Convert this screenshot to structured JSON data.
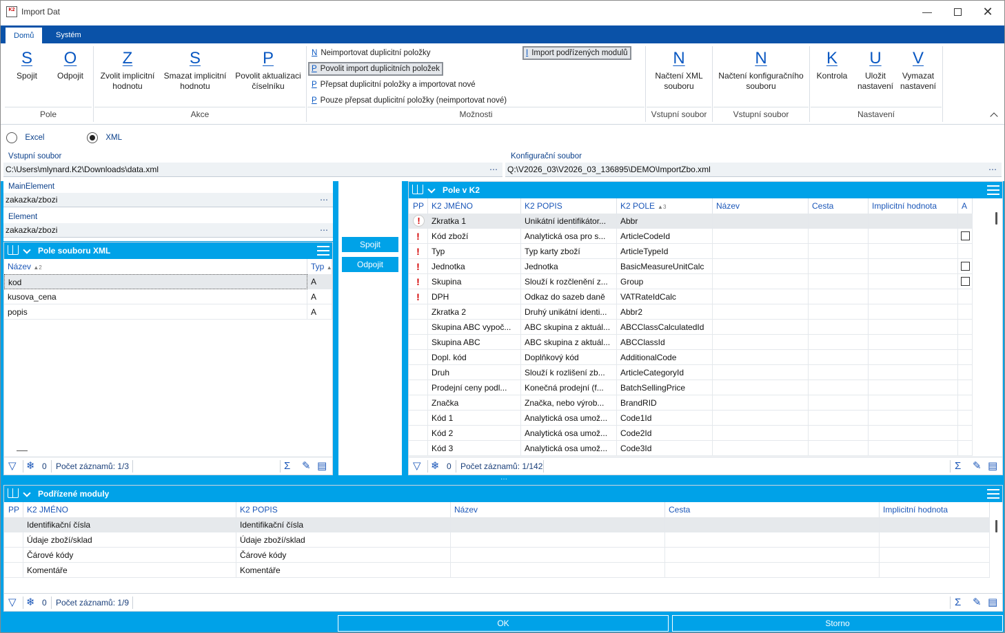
{
  "window": {
    "title": "Import Dat",
    "app_icon": "K2"
  },
  "ribbon": {
    "tabs": [
      "Domů",
      "Systém"
    ],
    "buttons": {
      "spojit": {
        "key": "S",
        "label": "Spojit"
      },
      "odpojit": {
        "key": "O",
        "label": "Odpojit"
      },
      "zvolit": {
        "key": "Z",
        "label1": "Zvolit implicitní",
        "label2": "hodnotu"
      },
      "smazat": {
        "key": "S",
        "label1": "Smazat implicitní",
        "label2": "hodnotu"
      },
      "povolit": {
        "key": "P",
        "label1": "Povolit aktualizaci",
        "label2": "číselníku"
      },
      "nacteni_xml": {
        "key": "N",
        "label1": "Načtení XML",
        "label2": "souboru"
      },
      "nacteni_konf": {
        "key": "N",
        "label1": "Načtení konfiguračního",
        "label2": "souboru"
      },
      "kontrola": {
        "key": "K",
        "label": "Kontrola"
      },
      "ulozit": {
        "key": "U",
        "label1": "Uložit",
        "label2": "nastavení"
      },
      "vymazat": {
        "key": "V",
        "label1": "Vymazat",
        "label2": "nastavení"
      }
    },
    "options": [
      {
        "key": "N",
        "label": "Neimportovat duplicitní položky"
      },
      {
        "key": "P",
        "label": "Povolit import duplicitních položek"
      },
      {
        "key": "P",
        "label": "Přepsat duplicitní položky a importovat nové"
      },
      {
        "key": "P",
        "label": "Pouze přepsat duplicitní položky (neimportovat nové)"
      }
    ],
    "import_sub": {
      "key": "I",
      "label": "Import podřízených modulů"
    },
    "groups": {
      "pole": "Pole",
      "akce": "Akce",
      "moznosti": "Možnosti",
      "vstup1": "Vstupní soubor",
      "vstup2": "Vstupní soubor",
      "nastaveni": "Nastavení"
    }
  },
  "source": {
    "excel": "Excel",
    "xml": "XML",
    "selected": "XML"
  },
  "input_file": {
    "label": "Vstupní soubor",
    "value": "C:\\Users\\mlynard.K2\\Downloads\\data.xml"
  },
  "config_file": {
    "label": "Konfigurační soubor",
    "value": "Q:\\V2026_03\\V2026_03_136895\\DEMO\\ImportZbo.xml"
  },
  "main_element": {
    "label": "MainElement",
    "value": "zakazka/zbozi"
  },
  "element": {
    "label": "Element",
    "value": "zakazka/zbozi"
  },
  "xml_panel": {
    "title": "Pole souboru XML",
    "columns": [
      "Název",
      "Typ"
    ],
    "sort_idx": "2",
    "rows": [
      {
        "name": "kod",
        "typ": "A"
      },
      {
        "name": "kusova_cena",
        "typ": "A"
      },
      {
        "name": "popis",
        "typ": "A"
      }
    ],
    "footer": {
      "count": "0",
      "records": "Počet záznamů: 1/3"
    }
  },
  "middle": {
    "spojit": "Spojit",
    "odpojit": "Odpojit"
  },
  "k2_panel": {
    "title": "Pole v K2",
    "columns": [
      "PP",
      "K2 JMÉNO",
      "K2 POPIS",
      "K2 POLE",
      "Název",
      "Cesta",
      "Implicitní hodnota",
      "A"
    ],
    "sort_idx": "3",
    "rows": [
      {
        "pp": "!",
        "name": "Zkratka 1",
        "desc": "Unikátní identifikátor...",
        "field": "Abbr",
        "chk": false
      },
      {
        "pp": "!",
        "name": "Kód zboží",
        "desc": "Analytická osa pro s...",
        "field": "ArticleCodeId",
        "chk": true
      },
      {
        "pp": "!",
        "name": "Typ",
        "desc": "Typ karty zboží",
        "field": "ArticleTypeId",
        "chk": false
      },
      {
        "pp": "!",
        "name": "Jednotka",
        "desc": "Jednotka",
        "field": "BasicMeasureUnitCalc",
        "chk": true
      },
      {
        "pp": "!",
        "name": "Skupina",
        "desc": "Slouží k rozčlenění z...",
        "field": "Group",
        "chk": true
      },
      {
        "pp": "!",
        "name": "DPH",
        "desc": "Odkaz do sazeb daně",
        "field": "VATRateIdCalc",
        "chk": false
      },
      {
        "pp": "",
        "name": "Zkratka 2",
        "desc": "Druhý unikátní identi...",
        "field": "Abbr2",
        "chk": false
      },
      {
        "pp": "",
        "name": "Skupina ABC vypoč...",
        "desc": "ABC skupina z aktuál...",
        "field": "ABCClassCalculatedId",
        "chk": false
      },
      {
        "pp": "",
        "name": "Skupina ABC",
        "desc": "ABC skupina z aktuál...",
        "field": "ABCClassId",
        "chk": false
      },
      {
        "pp": "",
        "name": "Dopl. kód",
        "desc": "Doplňkový kód",
        "field": "AdditionalCode",
        "chk": false
      },
      {
        "pp": "",
        "name": "Druh",
        "desc": "Slouží k rozlišení zb...",
        "field": "ArticleCategoryId",
        "chk": false
      },
      {
        "pp": "",
        "name": "Prodejní ceny podl...",
        "desc": "Konečná prodejní (f...",
        "field": "BatchSellingPrice",
        "chk": false
      },
      {
        "pp": "",
        "name": "Značka",
        "desc": "Značka, nebo výrob...",
        "field": "BrandRID",
        "chk": false
      },
      {
        "pp": "",
        "name": "Kód 1",
        "desc": "Analytická osa umož...",
        "field": "Code1Id",
        "chk": false
      },
      {
        "pp": "",
        "name": "Kód 2",
        "desc": "Analytická osa umož...",
        "field": "Code2Id",
        "chk": false
      },
      {
        "pp": "",
        "name": "Kód 3",
        "desc": "Analytická osa umož...",
        "field": "Code3Id",
        "chk": false
      }
    ],
    "footer": {
      "count": "0",
      "records": "Počet záznamů: 1/142"
    }
  },
  "sub_panel": {
    "title": "Podřízené moduly",
    "columns": [
      "PP",
      "K2 JMÉNO",
      "K2 POPIS",
      "Název",
      "Cesta",
      "Implicitní hodnota"
    ],
    "rows": [
      {
        "name": "Identifikační čísla",
        "desc": "Identifikační čísla"
      },
      {
        "name": "Údaje zboží/sklad",
        "desc": "Údaje zboží/sklad"
      },
      {
        "name": "Čárové kódy",
        "desc": "Čárové kódy"
      },
      {
        "name": "Komentáře",
        "desc": "Komentáře"
      }
    ],
    "footer": {
      "count": "0",
      "records": "Počet záznamů: 1/9"
    }
  },
  "bottom": {
    "ok": "OK",
    "storno": "Storno"
  },
  "colors": {
    "accent": "#00a2e8",
    "ribbon_tab": "#0a52a8",
    "key_letter": "#0a58c2",
    "required": "#d40000"
  }
}
